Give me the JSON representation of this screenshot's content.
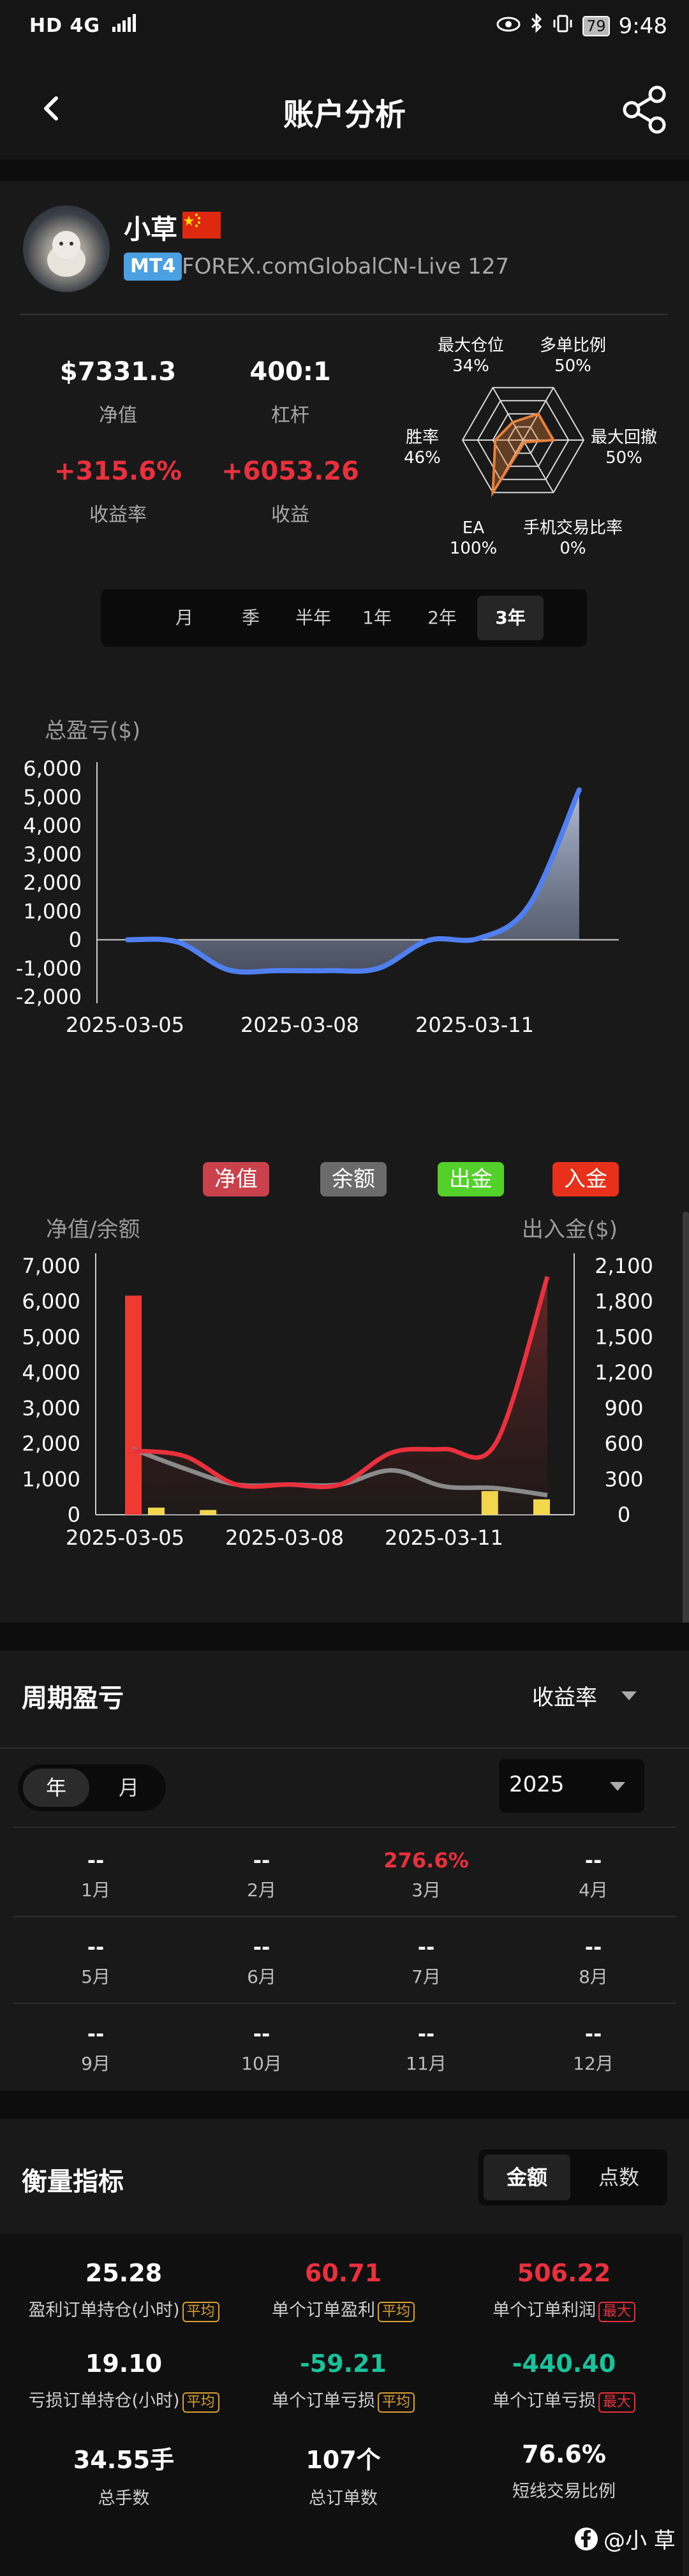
{
  "status_bar": {
    "left": "HD 4G",
    "time": "9:48",
    "battery": "79"
  },
  "header": {
    "title": "账户分析"
  },
  "account": {
    "name": "小草",
    "platform_tag": "MT4",
    "server": "FOREX.comGlobalCN-Live 127"
  },
  "stats": [
    {
      "value": "$7331.3",
      "label": "净值",
      "color": "white"
    },
    {
      "value": "400:1",
      "label": "杠杆",
      "color": "white"
    },
    {
      "value": "+315.6%",
      "label": "收益率",
      "color": "red"
    },
    {
      "value": "+6053.26",
      "label": "收益",
      "color": "red"
    }
  ],
  "radar": {
    "labels": [
      {
        "name": "最大仓位",
        "value": "34%"
      },
      {
        "name": "多单比例",
        "value": "50%"
      },
      {
        "name": "最大回撤",
        "value": "50%"
      },
      {
        "name": "手机交易比率",
        "value": "0%"
      },
      {
        "name": "EA",
        "value": "100%"
      },
      {
        "name": "胜率",
        "value": "46%"
      }
    ],
    "fractions": [
      0.34,
      0.5,
      0.5,
      0.0,
      1.0,
      0.46
    ]
  },
  "period_tabs": {
    "items": [
      "月",
      "季",
      "半年",
      "1年",
      "2年",
      "3年"
    ],
    "selected": "3年"
  },
  "chart_data": [
    {
      "type": "area",
      "title": "总盈亏($)",
      "x_ticks": [
        "2025-03-05",
        "2025-03-08",
        "2025-03-11"
      ],
      "y_ticks": [
        "6,000",
        "5,000",
        "4,000",
        "3,000",
        "2,000",
        "1,000",
        "0",
        "-1,000",
        "-2,000"
      ],
      "ylim": [
        -2000,
        6000
      ],
      "series": [
        {
          "x": [
            "2025-03-04",
            "2025-03-05",
            "2025-03-06",
            "2025-03-07",
            "2025-03-08",
            "2025-03-09",
            "2025-03-10",
            "2025-03-11",
            "2025-03-12",
            "2025-03-13"
          ],
          "values": [
            0,
            -80,
            -1050,
            -1080,
            -1080,
            -1000,
            -20,
            50,
            1200,
            5250
          ]
        }
      ]
    },
    {
      "type": "line",
      "legend": [
        "净值",
        "余额",
        "出金",
        "入金"
      ],
      "left_axis_title": "净值/余额",
      "right_axis_title": "出入金($)",
      "x_ticks": [
        "2025-03-05",
        "2025-03-08",
        "2025-03-11"
      ],
      "y_left_ticks": [
        "7,000",
        "6,000",
        "5,000",
        "4,000",
        "3,000",
        "2,000",
        "1,000",
        "0"
      ],
      "y_right_ticks": [
        "2,100",
        "1,800",
        "1,500",
        "1,200",
        "900",
        "600",
        "300",
        "0"
      ],
      "ylim_left": [
        0,
        7000
      ],
      "ylim_right": [
        0,
        2100
      ],
      "series": [
        {
          "name": "净值",
          "x": [
            "2025-03-05",
            "2025-03-06",
            "2025-03-07",
            "2025-03-08",
            "2025-03-09",
            "2025-03-10",
            "2025-03-11",
            "2025-03-12",
            "2025-03-13"
          ],
          "values": [
            1800,
            1650,
            850,
            850,
            850,
            1750,
            1850,
            2000,
            6700
          ]
        },
        {
          "name": "余额",
          "x": [
            "2025-03-05",
            "2025-03-06",
            "2025-03-07",
            "2025-03-08",
            "2025-03-09",
            "2025-03-10",
            "2025-03-11",
            "2025-03-12",
            "2025-03-13"
          ],
          "values": [
            1850,
            1300,
            850,
            850,
            850,
            1250,
            800,
            750,
            550
          ]
        },
        {
          "name": "入金",
          "x": [
            "2025-03-05"
          ],
          "values": [
            1850
          ]
        },
        {
          "name": "出金",
          "x": [
            "2025-03-05",
            "2025-03-06",
            "2025-03-12",
            "2025-03-13"
          ],
          "values": [
            60,
            40,
            200,
            130
          ]
        }
      ]
    }
  ],
  "period_pnl": {
    "title": "周期盈亏",
    "metric_select": "收益率",
    "toggle": [
      "年",
      "月"
    ],
    "toggle_selected": "年",
    "year_select": "2025",
    "months": [
      {
        "name": "1月",
        "value": "--"
      },
      {
        "name": "2月",
        "value": "--"
      },
      {
        "name": "3月",
        "value": "276.6%"
      },
      {
        "name": "4月",
        "value": "--"
      },
      {
        "name": "5月",
        "value": "--"
      },
      {
        "name": "6月",
        "value": "--"
      },
      {
        "name": "7月",
        "value": "--"
      },
      {
        "name": "8月",
        "value": "--"
      },
      {
        "name": "9月",
        "value": "--"
      },
      {
        "name": "10月",
        "value": "--"
      },
      {
        "name": "11月",
        "value": "--"
      },
      {
        "name": "12月",
        "value": "--"
      }
    ]
  },
  "metrics": {
    "title": "衡量指标",
    "tabs": [
      "金额",
      "点数"
    ],
    "tab_selected": "金额",
    "items": [
      {
        "value": "25.28",
        "label": "盈利订单持仓(小时)",
        "badge": "平均",
        "color": "white"
      },
      {
        "value": "60.71",
        "label": "单个订单盈利",
        "badge": "平均",
        "color": "red"
      },
      {
        "value": "506.22",
        "label": "单个订单利润",
        "badge": "最大",
        "color": "red"
      },
      {
        "value": "19.10",
        "label": "亏损订单持仓(小时)",
        "badge": "平均",
        "color": "white"
      },
      {
        "value": "-59.21",
        "label": "单个订单亏损",
        "badge": "平均",
        "color": "green"
      },
      {
        "value": "-440.40",
        "label": "单个订单亏损",
        "badge": "最大",
        "color": "green"
      },
      {
        "value": "34.55手",
        "label": "总手数",
        "badge": "",
        "color": "white"
      },
      {
        "value": "107个",
        "label": "总订单数",
        "badge": "",
        "color": "white"
      },
      {
        "value": "76.6%",
        "label": "短线交易比例",
        "badge": "",
        "color": "white"
      }
    ]
  },
  "watermark": "@小 草",
  "colors": {
    "red": "#e8313d",
    "green": "#19c29b",
    "blue": "#4f7ff0",
    "orange": "#e8823a",
    "yellow": "#f2d64b",
    "gray": "#8a8a8a",
    "lime": "#53d12a"
  }
}
